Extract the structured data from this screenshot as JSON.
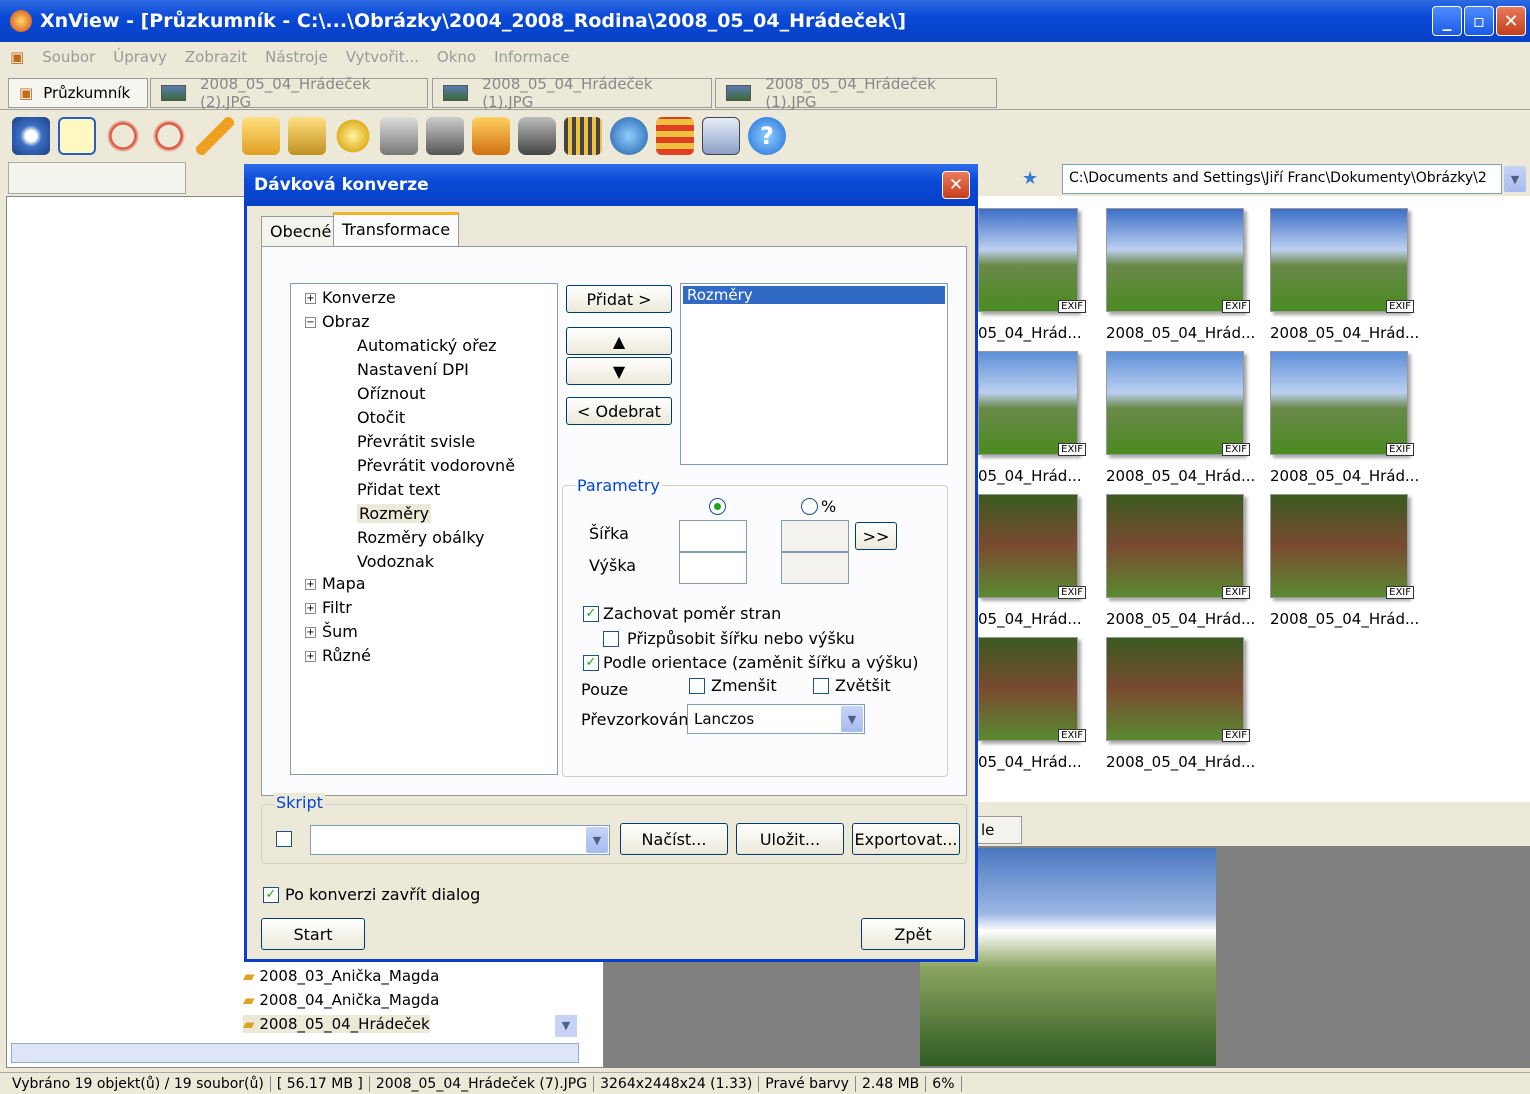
{
  "window": {
    "title": "XnView - [Průzkumník - C:\\...\\Obrázky\\2004_2008_Rodina\\2008_05_04_Hrádeček\\]",
    "min": "_",
    "max": "▫",
    "close": "✕"
  },
  "menu": [
    "Soubor",
    "Úpravy",
    "Zobrazit",
    "Nástroje",
    "Vytvořit...",
    "Okno",
    "Informace"
  ],
  "tabs": [
    {
      "label": "Průzkumník"
    },
    {
      "label": "2008_05_04_Hrádeček (2).JPG"
    },
    {
      "label": "2008_05_04_Hrádeček (1).JPG"
    },
    {
      "label": "2008_05_04_Hrádeček (1).JPG"
    }
  ],
  "address": "C:\\Documents and Settings\\Jiří Franc\\Dokumenty\\Obrázky\\2",
  "thumbs": {
    "caption_full": "2008_05_04_Hrád...",
    "caption_cut": "05_04_Hrád...",
    "exif": "EXIF"
  },
  "folders": [
    "2008_03_Anička_Magda",
    "2008_04_Anička_Magda",
    "2008_05_04_Hrádeček"
  ],
  "status": [
    "Vybráno 19 objekt(ů) / 19 soubor(ů)",
    "[ 56.17 MB ]",
    "2008_05_04_Hrádeček (7).JPG",
    "3264x2448x24 (1.33)",
    "Pravé barvy",
    "2.48 MB",
    "6%"
  ],
  "dialog": {
    "title": "Dávková konverze",
    "tab_general": "Obecné",
    "tab_transform": "Transformace",
    "tree": {
      "konverze": "Konverze",
      "obraz": "Obraz",
      "children": [
        "Automatický ořez",
        "Nastavení DPI",
        "Oříznout",
        "Otočit",
        "Převrátit svisle",
        "Převrátit vodorovně",
        "Přidat text",
        "Rozměry",
        "Rozměry obálky",
        "Vodoznak"
      ],
      "mapa": "Mapa",
      "filtr": "Filtr",
      "sum": "Šum",
      "ruzne": "Různé"
    },
    "add": "Přidat >",
    "up": "▲",
    "down": "▼",
    "remove": "< Odebrat",
    "list_item": "Rozměry",
    "params": "Parametry",
    "percent": "%",
    "width": "Šířka",
    "height": "Výška",
    "arrow": ">>",
    "keep_ratio": "Zachovat poměr stran",
    "fit": "Přizpůsobit šířku nebo výšku",
    "orient": "Podle orientace (zaměnit šířku a výšku)",
    "only": "Pouze",
    "shrink": "Zmenšit",
    "enlarge": "Zvětšit",
    "resample": "Převzorkován",
    "resample_value": "Lanczos",
    "script": "Skript",
    "load": "Načíst...",
    "save": "Uložit...",
    "export": "Exportovat...",
    "close_after": "Po konverzi zavřít dialog",
    "start": "Start",
    "back": "Zpět"
  },
  "preview_tab": "le"
}
